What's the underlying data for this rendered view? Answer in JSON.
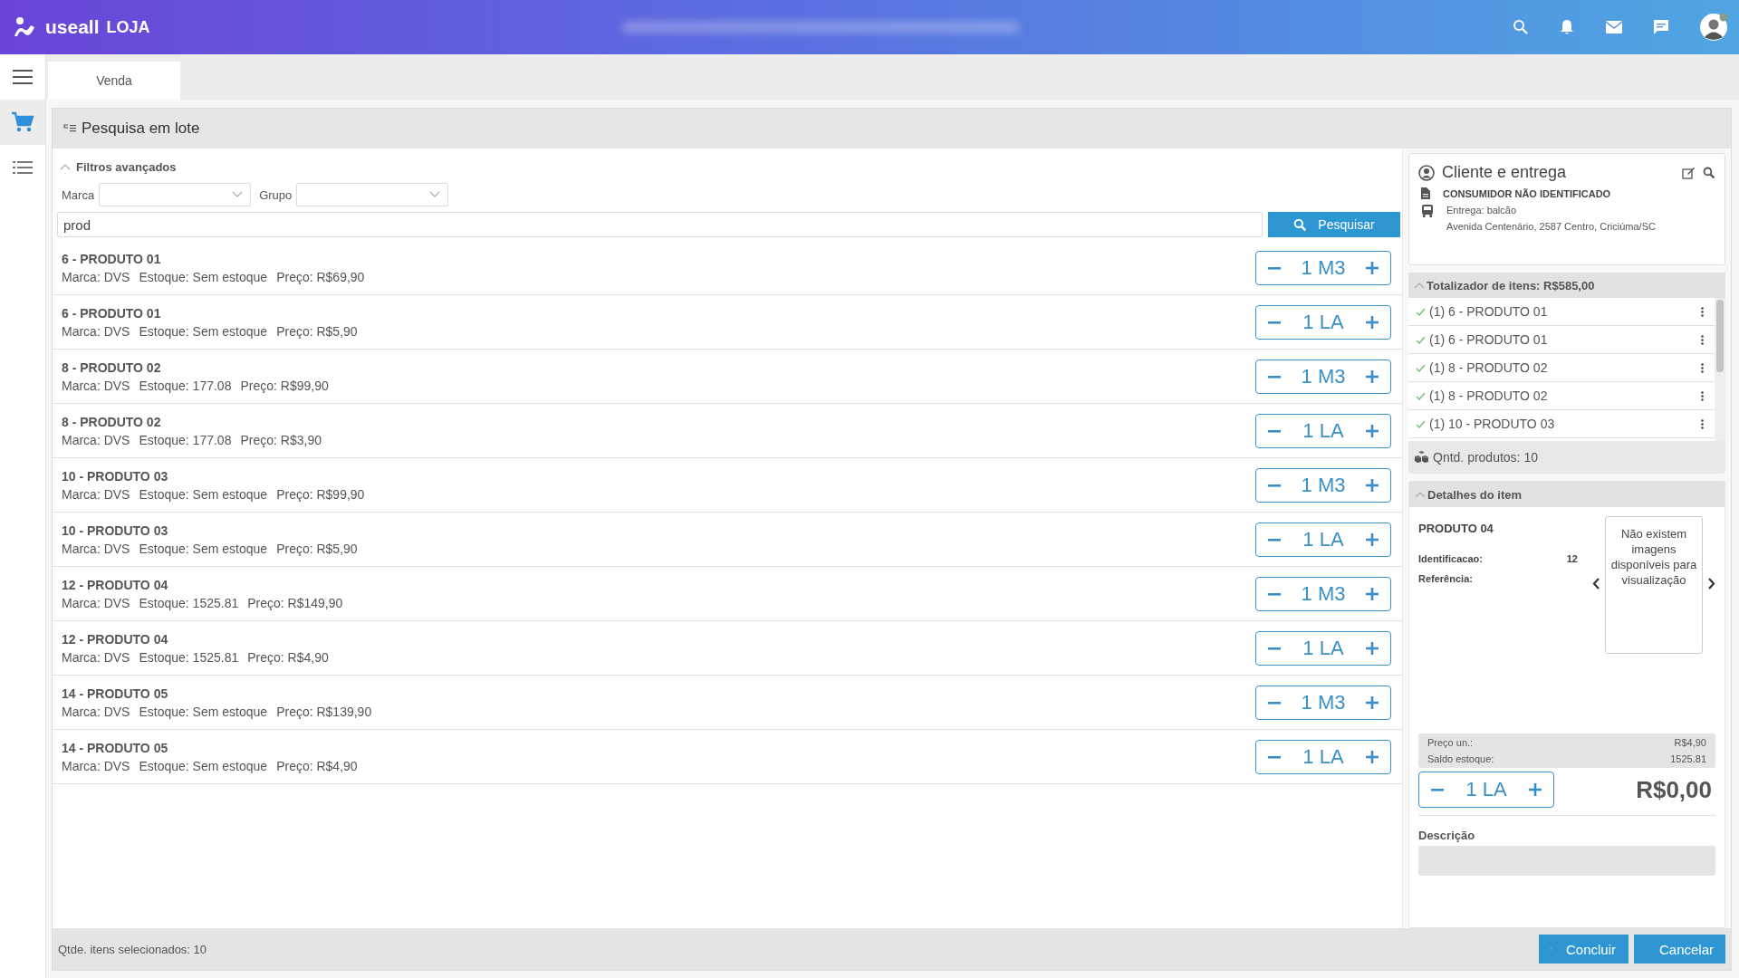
{
  "brand": {
    "name": "useall",
    "module": "LOJA"
  },
  "sidebar": {
    "items": [
      {
        "kind": "menu",
        "selected": false
      },
      {
        "kind": "cart",
        "selected": true
      },
      {
        "kind": "list",
        "selected": false
      }
    ]
  },
  "tabs": [
    {
      "label": "Venda",
      "selected": true
    }
  ],
  "panel": {
    "title": "Pesquisa em lote"
  },
  "filters": {
    "title": "Filtros avançados",
    "expanded": true,
    "fields": [
      {
        "label": "Marca"
      },
      {
        "label": "Grupo"
      }
    ],
    "search_value": "prod",
    "search_button": "Pesquisar"
  },
  "products": [
    {
      "title": "6 - PRODUTO 01",
      "brand": "Marca: DVS",
      "stock": "Estoque: Sem estoque",
      "price": "Preço: R$69,90",
      "qty": "1 M3"
    },
    {
      "title": "6 - PRODUTO 01",
      "brand": "Marca: DVS",
      "stock": "Estoque: Sem estoque",
      "price": "Preço: R$5,90",
      "qty": "1 LA"
    },
    {
      "title": "8 - PRODUTO 02",
      "brand": "Marca: DVS",
      "stock": "Estoque: 177.08",
      "price": "Preço: R$99,90",
      "qty": "1 M3"
    },
    {
      "title": "8 - PRODUTO 02",
      "brand": "Marca: DVS",
      "stock": "Estoque: 177.08",
      "price": "Preço: R$3,90",
      "qty": "1 LA"
    },
    {
      "title": "10 - PRODUTO 03",
      "brand": "Marca: DVS",
      "stock": "Estoque: Sem estoque",
      "price": "Preço: R$99,90",
      "qty": "1 M3"
    },
    {
      "title": "10 - PRODUTO 03",
      "brand": "Marca: DVS",
      "stock": "Estoque: Sem estoque",
      "price": "Preço: R$5,90",
      "qty": "1 LA"
    },
    {
      "title": "12 - PRODUTO 04",
      "brand": "Marca: DVS",
      "stock": "Estoque: 1525.81",
      "price": "Preço: R$149,90",
      "qty": "1 M3"
    },
    {
      "title": "12 - PRODUTO 04",
      "brand": "Marca: DVS",
      "stock": "Estoque: 1525.81",
      "price": "Preço: R$4,90",
      "qty": "1 LA"
    },
    {
      "title": "14 - PRODUTO 05",
      "brand": "Marca: DVS",
      "stock": "Estoque: Sem estoque",
      "price": "Preço: R$139,90",
      "qty": "1 M3"
    },
    {
      "title": "14 - PRODUTO 05",
      "brand": "Marca: DVS",
      "stock": "Estoque: Sem estoque",
      "price": "Preço: R$4,90",
      "qty": "1 LA"
    }
  ],
  "client": {
    "title": "Cliente e entrega",
    "customer": "CONSUMIDOR NÃO IDENTIFICADO",
    "delivery": "Entrega: balcão",
    "address": "Avenida Centenário, 2587 Centro, Criciúma/SC"
  },
  "totals": {
    "title": "Totalizador de itens: R$585,00",
    "expanded": true,
    "items": [
      {
        "label": "(1) 6 - PRODUTO 01",
        "checked": true
      },
      {
        "label": "(1) 6 - PRODUTO 01",
        "checked": true
      },
      {
        "label": "(1) 8 - PRODUTO 02",
        "checked": true
      },
      {
        "label": "(1) 8 - PRODUTO 02",
        "checked": true
      },
      {
        "label": "(1) 10 - PRODUTO 03",
        "checked": true
      }
    ],
    "count": "Qntd. produtos: 10"
  },
  "details": {
    "title": "Detalhes do item",
    "expanded": true,
    "name": "PRODUTO 04",
    "fields": [
      {
        "label": "Identificacao:",
        "value": "12"
      },
      {
        "label": "Referência:"
      }
    ],
    "no_image": "Não existem imagens disponíveis para visualização",
    "summary": [
      {
        "label": "Preço un.:",
        "value": "R$4,90"
      },
      {
        "label": "Saldo estoque:",
        "value": "1525.81"
      }
    ],
    "qty": "1 LA",
    "total": "R$0,00",
    "description_label": "Descrição"
  },
  "footer": {
    "selected_count": "Qtde. itens selecionados: 10",
    "buttons": [
      {
        "kind": "confirm",
        "label": "Concluir"
      },
      {
        "kind": "cancel",
        "label": "Cancelar"
      }
    ]
  }
}
